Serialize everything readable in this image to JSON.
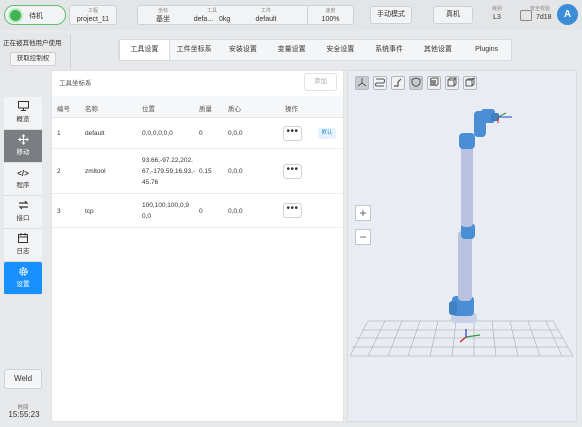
{
  "topbar": {
    "status": "待机",
    "project": {
      "label": "工程",
      "value": "project_11"
    },
    "coord": {
      "label": "坐标",
      "value": "基坐"
    },
    "tool": {
      "label": "工具",
      "value": "defa...",
      "payload": "0kg"
    },
    "workpiece": {
      "label": "工件",
      "value": "default"
    },
    "speed": {
      "label": "速度",
      "value": "100%"
    },
    "mode_button": "手动模式",
    "machine_button": "真机",
    "level": {
      "label": "级别",
      "value": "L3"
    },
    "safety": {
      "label": "安全校验",
      "value": "7d18"
    },
    "avatar": "A"
  },
  "notice": {
    "text": "正在被其他用户使用",
    "button": "获取控制权"
  },
  "tabs": [
    {
      "label": "工具设置",
      "active": true
    },
    {
      "label": "工件坐标系",
      "active": false
    },
    {
      "label": "安装设置",
      "active": false
    },
    {
      "label": "变量设置",
      "active": false
    },
    {
      "label": "安全设置",
      "active": false
    },
    {
      "label": "系统事件",
      "active": false
    },
    {
      "label": "其他设置",
      "active": false
    },
    {
      "label": "Plugins",
      "active": false
    }
  ],
  "sidebar": [
    {
      "label": "概览",
      "icon": "monitor-icon"
    },
    {
      "label": "移动",
      "icon": "move-icon"
    },
    {
      "label": "程序",
      "icon": "code-icon"
    },
    {
      "label": "接口",
      "icon": "swap-icon"
    },
    {
      "label": "日志",
      "icon": "calendar-icon"
    },
    {
      "label": "设置",
      "icon": "gear-icon"
    }
  ],
  "weld_button": "Weld",
  "time": {
    "label": "时间",
    "value": "15:55:23"
  },
  "panel": {
    "title": "工具坐标系",
    "add_button": "添加",
    "columns": [
      "编号",
      "名称",
      "位置",
      "质量",
      "质心",
      "操作"
    ],
    "rows": [
      {
        "id": "1",
        "name": "default",
        "position": "0,0,0,0,0,0",
        "mass": "0",
        "centroid": "0,0,0",
        "tag": "默认"
      },
      {
        "id": "2",
        "name": "zmltool",
        "position": "93.66,-97.22,202.67,-179.59,16.93,-45.76",
        "mass": "0.15",
        "centroid": "0,0,0",
        "tag": ""
      },
      {
        "id": "3",
        "name": "tcp",
        "position": "100,100,100,0,90,0",
        "mass": "0",
        "centroid": "0,0,0",
        "tag": ""
      }
    ],
    "op_button": "•••"
  },
  "viewport": {
    "zoom_in": "+",
    "zoom_out": "−",
    "robot_color": "#4a8fd6",
    "link_color": "#b9c3df"
  }
}
